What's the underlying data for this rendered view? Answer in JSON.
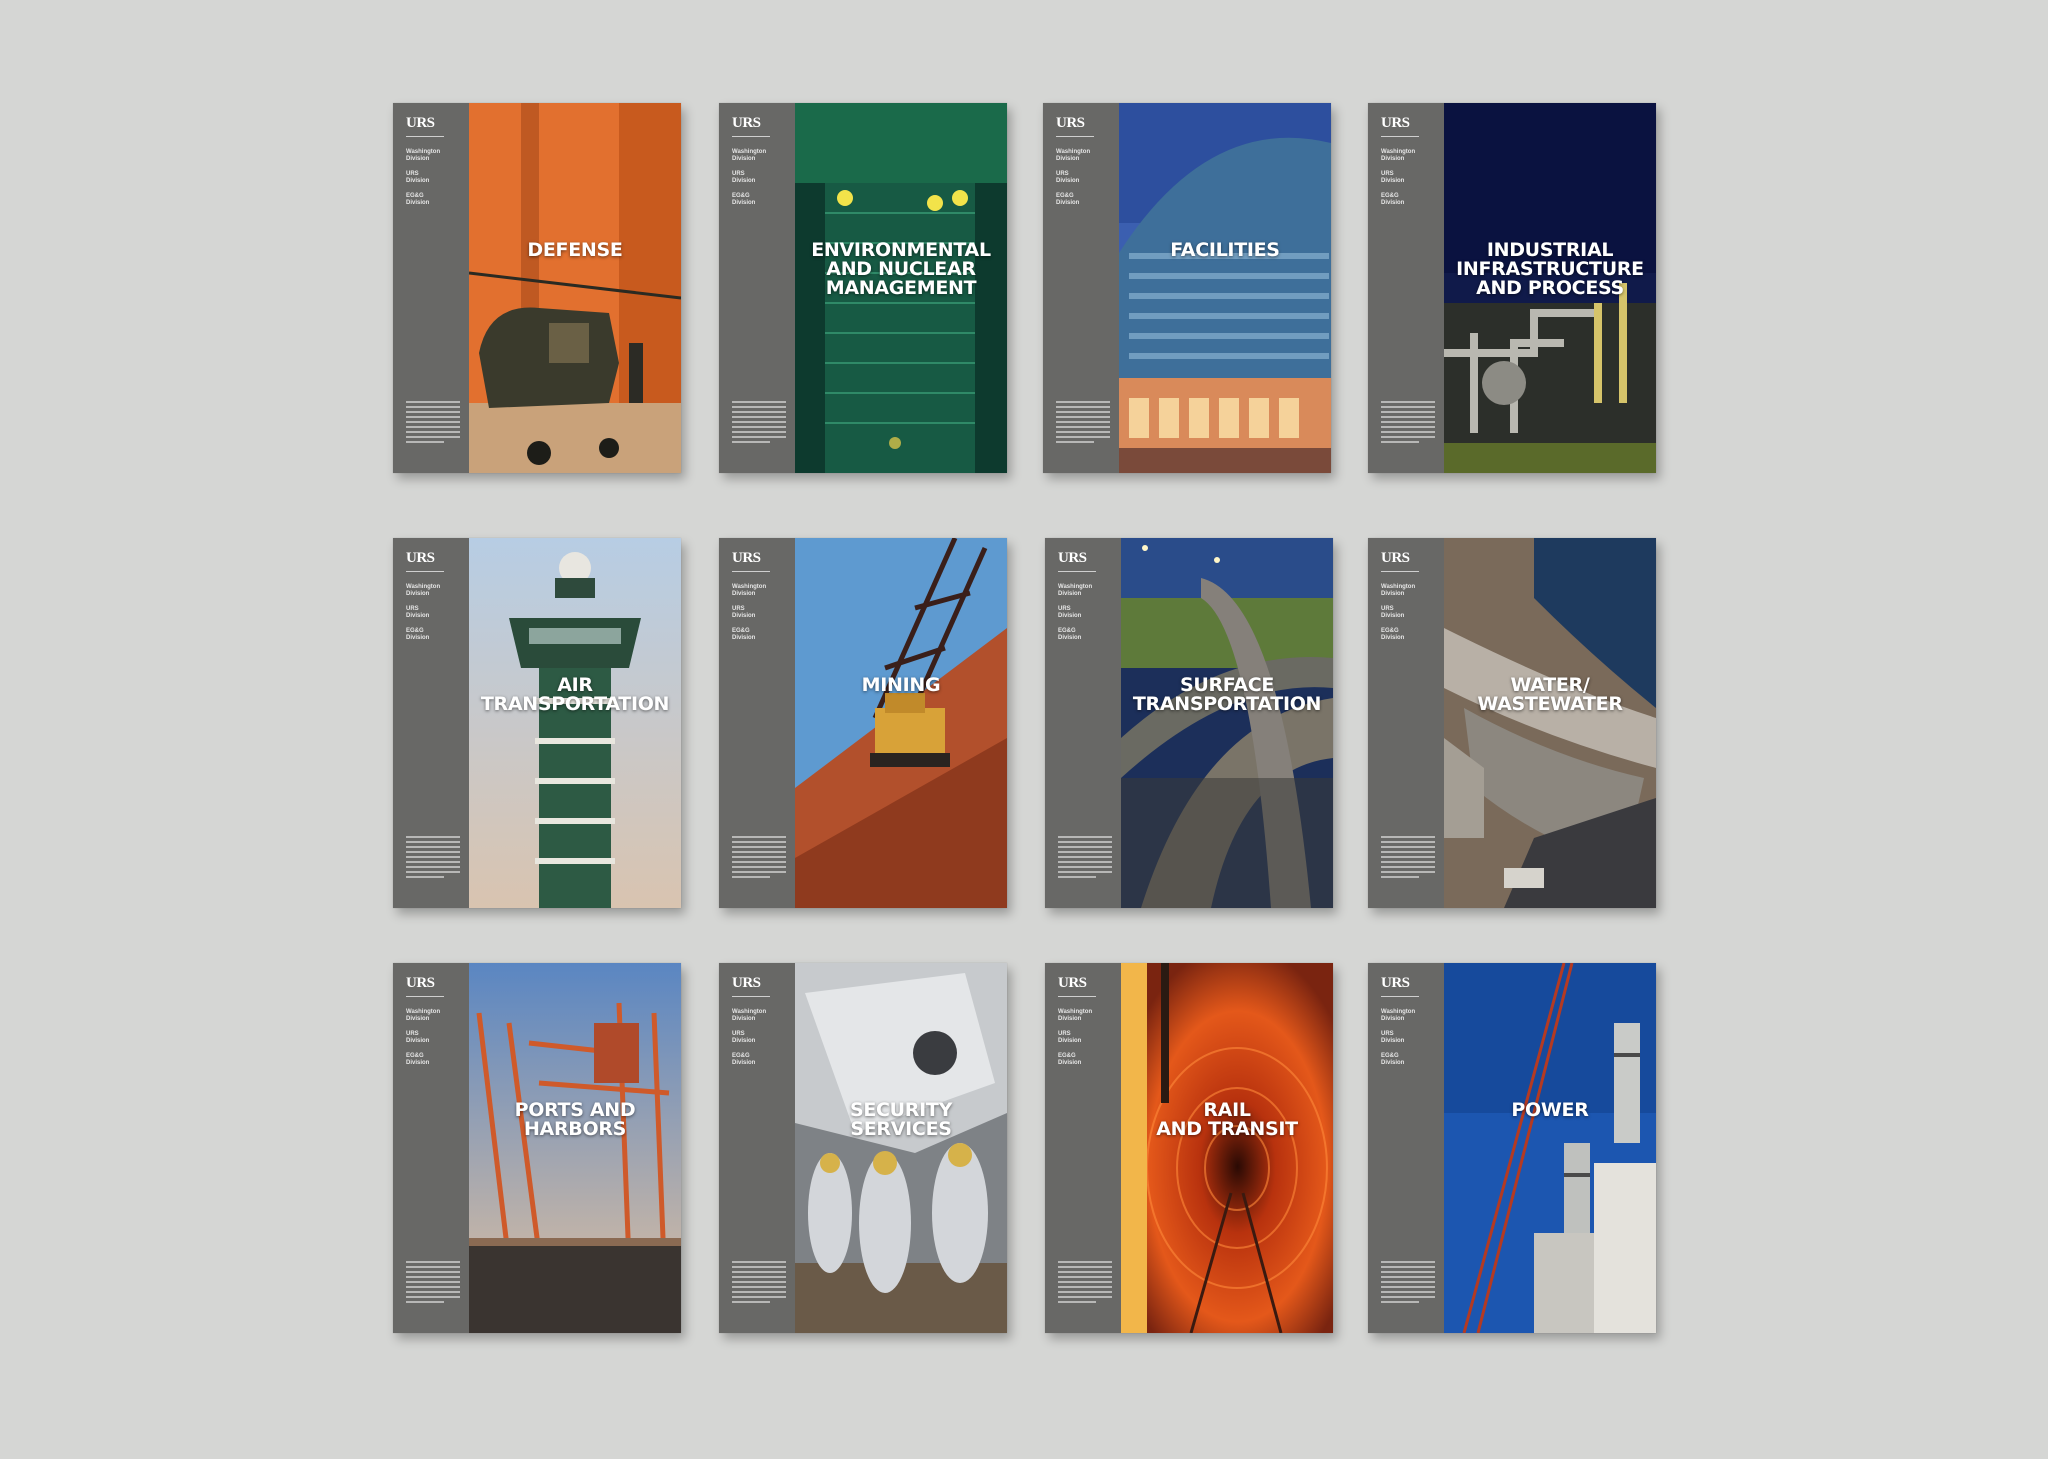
{
  "brand": "URS",
  "divisions": [
    "Washington\nDivision",
    "URS\nDivision",
    "EG&G\nDivision"
  ],
  "brochures": [
    {
      "title": "DEFENSE",
      "scene": "defense"
    },
    {
      "title": "ENVIRONMENTAL\nAND NUCLEAR\nMANAGEMENT",
      "scene": "environmental"
    },
    {
      "title": "FACILITIES",
      "scene": "facilities"
    },
    {
      "title": "INDUSTRIAL\nINFRASTRUCTURE\nAND PROCESS",
      "scene": "industrial"
    },
    {
      "title": "AIR\nTRANSPORTATION",
      "scene": "air"
    },
    {
      "title": "MINING",
      "scene": "mining"
    },
    {
      "title": "SURFACE\nTRANSPORTATION",
      "scene": "surface"
    },
    {
      "title": "WATER/\nWASTEWATER",
      "scene": "water"
    },
    {
      "title": "PORTS AND\nHARBORS",
      "scene": "ports"
    },
    {
      "title": "SECURITY\nSERVICES",
      "scene": "security"
    },
    {
      "title": "RAIL\nAND TRANSIT",
      "scene": "rail"
    },
    {
      "title": "POWER",
      "scene": "power"
    }
  ]
}
